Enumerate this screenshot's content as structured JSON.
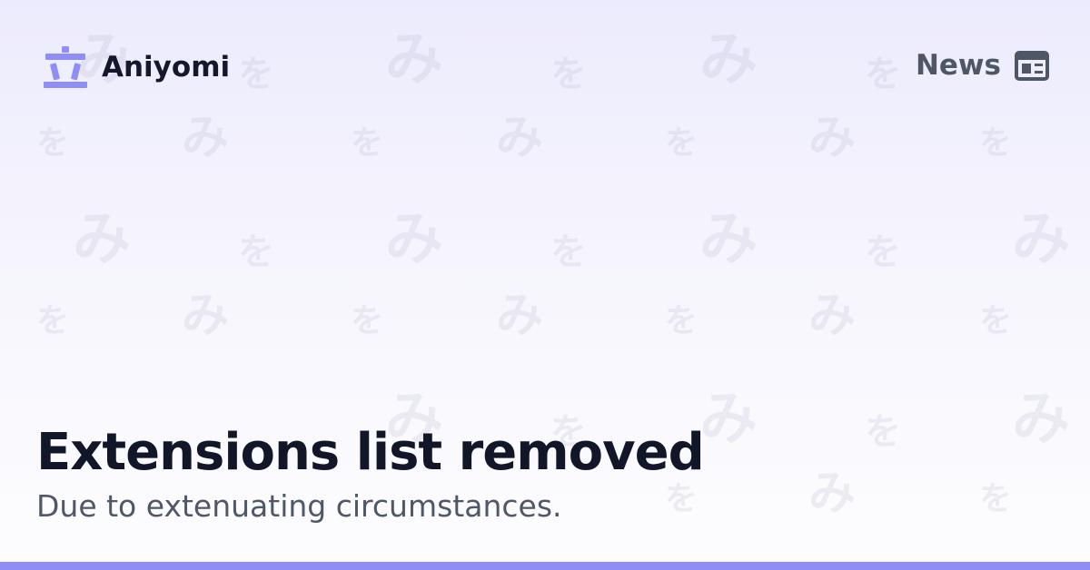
{
  "header": {
    "brand_name": "Aniyomi",
    "logo_icon": "aniyomi-logo-icon"
  },
  "nav": {
    "news_label": "News",
    "news_icon": "newspaper-icon"
  },
  "content": {
    "title": "Extensions list removed",
    "subtitle": "Due to extenuating circumstances."
  },
  "colors": {
    "accent": "#8f8ef6",
    "title": "#111728",
    "subtitle": "#4f5868"
  }
}
